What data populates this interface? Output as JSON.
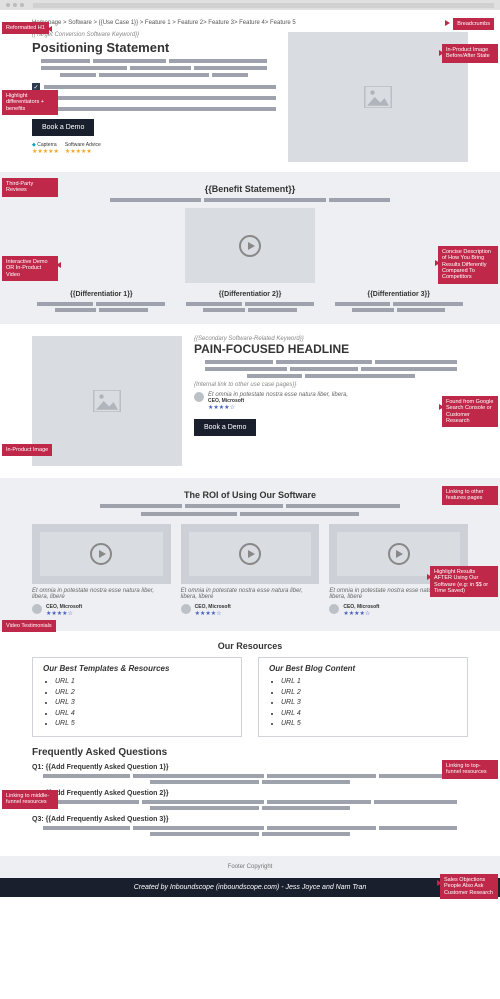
{
  "breadcrumb": "Homepage > Software > {{Use Case 1}} > Feature 1 > Feature 2> Feature 3> Feature 4> Feature 5",
  "hero": {
    "eyebrow": "{{Target Conversion Software Keyword}}",
    "h1": "Positioning Statement",
    "cta": "Book a Demo",
    "review1": "Capterra",
    "review2": "Software Advice",
    "stars": "★★★★★"
  },
  "benefit": {
    "title": "{{Benefit Statement}}",
    "d1": "{{Differentiatior 1}}",
    "d2": "{{Differentiatior 2}}",
    "d3": "{{Differentiatior 3}}"
  },
  "pain": {
    "eyebrow": "{{Secondary Software-Related Keyword}}",
    "h2": "PAIN-FOCUSED HEADLINE",
    "internal": "{Internal link to other use case pages}}",
    "quote": "Et omnia in potestate nostra esse natura liber, libera,",
    "role": "CEO, Microsoft",
    "stars": "★★★★☆",
    "cta": "Book a Demo"
  },
  "roi": {
    "title": "The ROI of Using Our Software",
    "quote": "Et omnia in potestate nostra esse natura liber, libera, libere",
    "role": "CEO, Microsoft",
    "stars": "★★★★☆"
  },
  "resources": {
    "title": "Our Resources",
    "col1_title": "Our Best Templates & Resources",
    "col2_title": "Our Best Blog Content",
    "u1": "URL 1",
    "u2": "URL 2",
    "u3": "URL 3",
    "u4": "URL 4",
    "u5": "URL 5"
  },
  "faq": {
    "title": "Frequently Asked Questions",
    "q1": "Q1: {{Add Frequently Asked Question 1}}",
    "q2": "Q2: {{Add Frequently Asked Question 2}}",
    "q3": "Q3: {{Add Frequently Asked Question 3}}"
  },
  "footer": "Footer Copyright",
  "credit": "Created by Inboundscope (inboundscope.com) - Jess Joyce and Nam Tran",
  "annotations": {
    "h1": "Reformatted H1",
    "bc": "Breadcrumbs",
    "img1": "In-Product Image Before/After State",
    "diff": "Highlight differentiators + benefits",
    "rev": "Third-Party Reviews",
    "demo": "Interactive Demo OR In-Product Video",
    "concise": "Concise Description of How You Bring Results Differently Compared To Competitors",
    "gsc": "Found from Google Search Console or Customer Research",
    "inprod": "In-Product Image",
    "link": "Linking to other features pages",
    "roi": "Highlight Results AFTER Using Our Software (e.g: in $$ or Time Saved)",
    "vidtest": "Video Testimonials",
    "mid": "Linking to middle-funnel resources",
    "top": "Linking to top-funnel resources",
    "sales": "Sales Objections People Also Ask Customer Research"
  }
}
